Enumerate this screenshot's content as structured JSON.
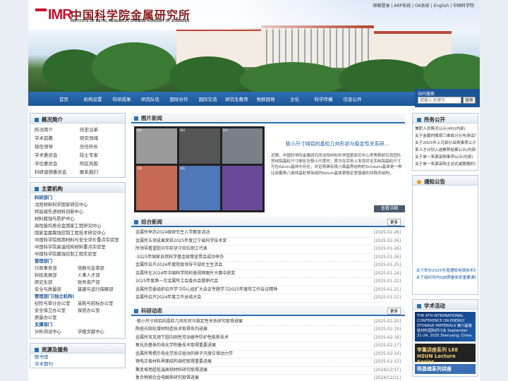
{
  "header": {
    "logo_text": "IMR",
    "cn_name": "中国科学院金属研究所",
    "en_name": "INSTITUTE OF METAL RESEARCH, CHINESE ACADEMY OF SCIENCES",
    "top_links": "邮箱登录 | ARP系统 | OA系统 | English | 中国科学院"
  },
  "nav": [
    "首页",
    "机构设置",
    "科研成果",
    "研究队伍",
    "国际合作",
    "国际交流",
    "研究生教育",
    "党群园地",
    "文化",
    "科学传播",
    "信息公开"
  ],
  "search": {
    "label": "站内搜索",
    "placeholder": "请输入关键字",
    "button": "搜索"
  },
  "overview": {
    "title": "概况简介",
    "items": [
      "所况简介",
      "历史沿革",
      "学术前瞻",
      "研究领域",
      "现任领导",
      "历任所长",
      "学术委员会",
      "院士专家",
      "学位委员会",
      "所区风貌",
      "科研道德委员会",
      "联系我们"
    ]
  },
  "orgs": {
    "title": "主要机构",
    "head1": "科研部门",
    "labs": [
      "沈阳材料科学国家研究中心",
      "师昌绪先进材料创新中心",
      "材料腐蚀与防护中心",
      "高性能均质合金国家工程研究中心",
      "国家金属腐蚀控制工程技术研究中心",
      "中国科学院核用材料与安全评价重点实验室",
      "中国科学院高温结构材料重点实验室",
      "中国科学院腐蚀控制工程实验室"
    ],
    "head2": "管理部门",
    "mgmt": [
      [
        "行政事务部",
        "党群与监审部"
      ],
      [
        "科技发展部",
        "人事人才部"
      ],
      [
        "研究生部",
        "财务资产部"
      ],
      [
        "安全与质量部",
        "基建与运行保障部"
      ]
    ],
    "head3": "管理部门(独立机构)",
    "indep": [
      [
        "纪检与审计办公室",
        "采购与招标办公室"
      ],
      [
        "安全保卫办公室",
        "保密办公室"
      ],
      [
        "质量办公室",
        ""
      ]
    ],
    "head4": "支撑部门",
    "support": [
      [
        "分析测试中心",
        "学报文献中心"
      ]
    ]
  },
  "resources": {
    "title": "资源及服务",
    "items": [
      "图书馆",
      "学术期刊"
    ]
  },
  "photo_news": {
    "title": "图片新闻",
    "headline": "极小尺寸纯铝的晶粒几何形状与稳定性关系研...",
    "body": "近期，中国科学院金属研究所沈阳材料科学国家研究中心李秀艳研究员团队将纯铝晶粒尺寸细化至极小尺度时，首次在实验上发现并证实纯铝晶粒尺寸可在Kelvin晶体中存在，并证明具有极小面晶界结构的Schwarz晶体是一种比由截角八面体晶粒堆垛成的Kelvin晶体更稳定更普遍的亚稳态结构。",
    "detail": "查看详细",
    "labels": [
      "(a)",
      "(b)",
      "(c)",
      "(d)",
      "(e)"
    ]
  },
  "general_news": {
    "title": "综合新闻",
    "more": "更多",
    "items": [
      [
        "金属所举办2024级研究生入学教育活动",
        "[2025-02-26]"
      ],
      [
        "金属所五项成果荣获2025年度辽宁省科学技术奖",
        "[2025-02-26]"
      ],
      [
        "所领导看望慰问节前坚守岗位职工代表",
        "[2025-01-26]"
      ],
      [
        "·2025年国家自然科学基金政策宣贯会成功举办",
        "[2025-01-26]"
      ],
      [
        "金属所召开2024年度院级领导干部民主生活会",
        "[2025-01-25]"
      ],
      [
        "金属所在2024年中国科学院科普视频图片大赛中获奖",
        "[2025-01-24]"
      ],
      [
        "2025年度第一次金属所工会委员会暨职代会",
        "[2025-01-22]"
      ],
      [
        "金属所党委组织召开学习中心组扩大会议专题学习2025年度院工作会议精神",
        "[2025-01-21]"
      ],
      [
        "金属所召开2024年度工作总结大会",
        "[2025-01-21]"
      ]
    ]
  },
  "research_news": {
    "title": "科研动态",
    "more": "更多",
    "items": [
      [
        "·极小尺寸纯铝的晶粒几何形状与稳定性关系研究取得进展",
        "[2025-02-20]"
      ],
      [
        "陶瓷光固化增材制造技术取得系列进展",
        "[2025-02-19]"
      ],
      [
        "金属所攻克颈下超向刚性可动器件防护性能新技术",
        "[2025-02-18]"
      ],
      [
        "氧化后基体的电化学制备技术取得重要进展",
        "[2025-02-17]"
      ],
      [
        "金属所等揭示电化学反应驱动的原子尺度位错动力学",
        "[2025-02-14]"
      ],
      [
        "锂电正极材料界面结构调控取得重要进展",
        "[2025-01-13]"
      ],
      [
        "聚变堆用超低温高韧材料研究取得进展",
        "[2024/12/17]"
      ],
      [
        "复合物钢合金电解质研究取得进展",
        "[2024/12/11]"
      ]
    ]
  },
  "announce": {
    "title": "所务公开",
    "items": [
      "兼职人员情况公示(40)(内部)",
      "关于金属的微观三维成分分布测试及结构表征服务采购项目的公示(内部)",
      "关于2025年上月部分采购事项公示(内部)",
      "某人才计划入选推荐结果公示(内部)",
      "关于单一来源采购事项公示(内部)",
      "关于单一来源采购主动式减震器的公示"
    ]
  },
  "notice": {
    "title": "通知公告",
    "items": [
      "·关于举办2025年度通知电镜技术培训的通知",
      "·关于组织所内DJB质量体系重要课题结负责"
    ]
  },
  "academic": {
    "title": "学术活动",
    "banner1": "THE 6TH INTERNATIONAL CONFERENCE ON ENERGY STORAGE MATERIALS 第六届储能材料国际研讨会 September 21-24, 2025 Shenyang, China",
    "banner2": "李薰讲座系列 LEE HSUN Lecture Series",
    "banner3": "师昌绪系列讲座"
  },
  "colors": {
    "nav": "#1c5596",
    "accent": "#2d6fb4",
    "brand_red": "#c8102e"
  }
}
